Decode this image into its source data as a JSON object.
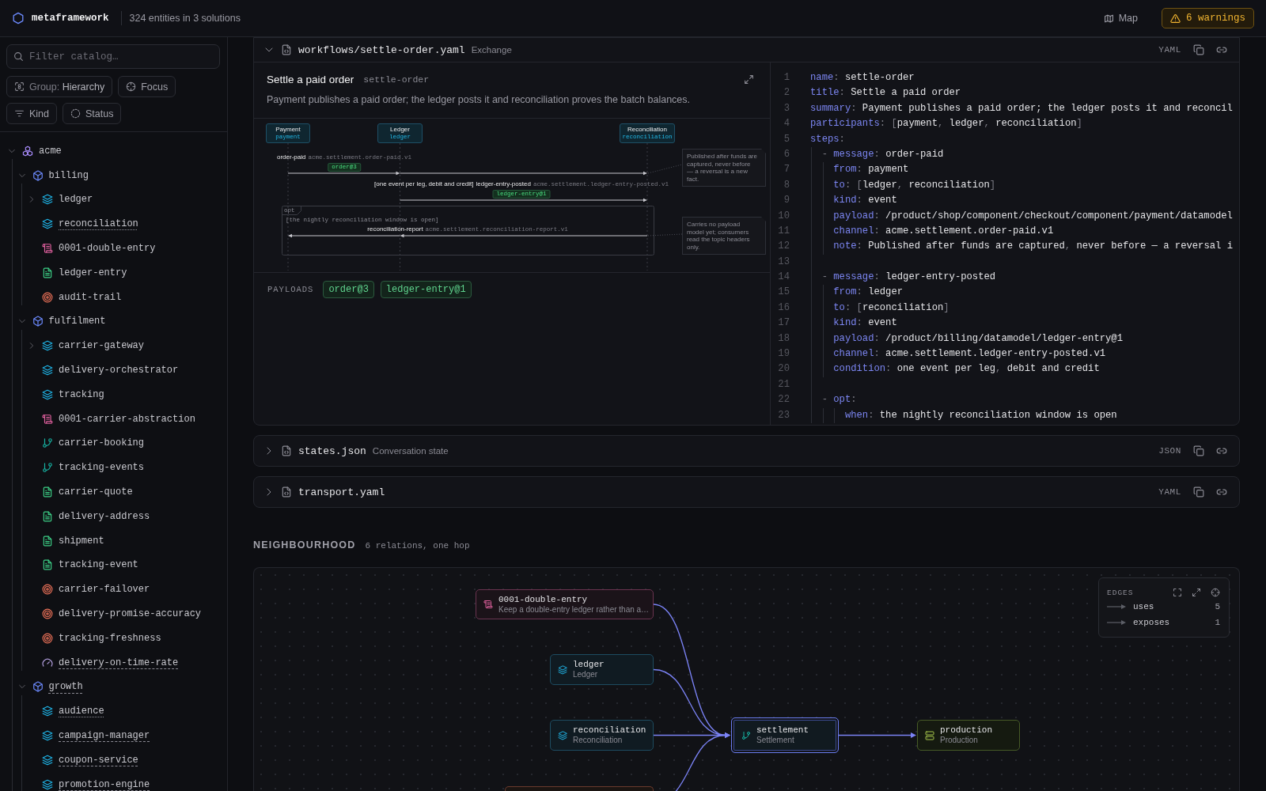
{
  "topbar": {
    "logo": "metaframework",
    "summary": "324 entities in 3 solutions",
    "map_button": "Map",
    "warnings_button": "6 warnings"
  },
  "sidebar": {
    "filter": {
      "placeholder": "Filter catalog…"
    },
    "controls": [
      {
        "kind": "group",
        "label": "Group:",
        "value": "Hierarchy"
      },
      {
        "kind": "focus",
        "label": "Focus"
      },
      {
        "kind": "kind",
        "label": "Kind"
      },
      {
        "kind": "status",
        "label": "Status"
      }
    ],
    "tree": [
      {
        "kind": "solution",
        "label": "acme",
        "expanded": true,
        "children": [
          {
            "kind": "domain",
            "label": "billing",
            "expanded": true,
            "children": [
              {
                "kind": "component",
                "label": "ledger",
                "expanded": false
              },
              {
                "kind": "component",
                "label": "reconciliation",
                "dotted_underline": true
              },
              {
                "kind": "decision",
                "label": "0001-double-entry"
              },
              {
                "kind": "datamodel",
                "label": "ledger-entry"
              },
              {
                "kind": "objective",
                "label": "audit-trail"
              }
            ]
          },
          {
            "kind": "domain",
            "label": "fulfilment",
            "expanded": true,
            "children": [
              {
                "kind": "component",
                "label": "carrier-gateway",
                "expanded": false
              },
              {
                "kind": "component",
                "label": "delivery-orchestrator"
              },
              {
                "kind": "component",
                "label": "tracking"
              },
              {
                "kind": "decision",
                "label": "0001-carrier-abstraction"
              },
              {
                "kind": "flow",
                "label": "carrier-booking"
              },
              {
                "kind": "flow",
                "label": "tracking-events"
              },
              {
                "kind": "datamodel",
                "label": "carrier-quote"
              },
              {
                "kind": "datamodel",
                "label": "delivery-address"
              },
              {
                "kind": "datamodel",
                "label": "shipment"
              },
              {
                "kind": "datamodel",
                "label": "tracking-event"
              },
              {
                "kind": "objective",
                "label": "carrier-failover"
              },
              {
                "kind": "objective",
                "label": "delivery-promise-accuracy"
              },
              {
                "kind": "objective",
                "label": "tracking-freshness"
              },
              {
                "kind": "metric",
                "label": "delivery-on-time-rate",
                "dashed_underline": true
              }
            ]
          },
          {
            "kind": "domain",
            "label": "growth",
            "expanded": true,
            "dashed_underline": true,
            "children": [
              {
                "kind": "component",
                "label": "audience",
                "dotted_underline": true
              },
              {
                "kind": "component",
                "label": "campaign-manager",
                "dashed_underline": true
              },
              {
                "kind": "component",
                "label": "coupon-service",
                "dashed_underline": true
              },
              {
                "kind": "component",
                "label": "promotion-engine",
                "dashed_underline": true
              }
            ]
          }
        ]
      }
    ]
  },
  "files": [
    {
      "expanded": true,
      "path": "workflows/settle-order.yaml",
      "description": "Exchange",
      "format": "YAML",
      "workflow": {
        "title": "Settle a paid order",
        "name": "settle-order",
        "summary": "Payment publishes a paid order; the ledger posts it and reconciliation proves the batch balances.",
        "participants": [
          {
            "title": "Payment",
            "name": "payment"
          },
          {
            "title": "Ledger",
            "name": "ledger"
          },
          {
            "title": "Reconciliation",
            "name": "reconciliation"
          }
        ],
        "messages": [
          {
            "reversed": false,
            "name": "order-paid",
            "channel": "acme.settlement.order-paid.v1",
            "payload": "order@3"
          },
          {
            "reversed": false,
            "guard": "[one event per leg, debit and credit]",
            "name": "ledger-entry-posted",
            "channel": "acme.settlement.ledger-entry-posted.v1",
            "payload": "ledger-entry@1"
          },
          {
            "reversed": true,
            "name": "reconciliation-report",
            "channel": "acme.settlement.reconciliation-report.v1"
          }
        ],
        "fragment": {
          "label": "opt",
          "condition": "[the nightly reconciliation window is open]"
        },
        "notes": [
          "Published after funds are captured, never before — a reversal is a new fact.",
          "Carries no payload model yet; consumers read the topic headers only."
        ],
        "payloads_label": "PAYLOADS",
        "payloads": [
          "order@3",
          "ledger-entry@1"
        ]
      },
      "code": [
        {
          "number": "1",
          "text": "name: settle-order"
        },
        {
          "number": "2",
          "text": "title: Settle a paid order"
        },
        {
          "number": "3",
          "text": "summary: Payment publishes a paid order; the ledger posts it and reconcil"
        },
        {
          "number": "4",
          "text": "participants: [payment, ledger, reconciliation]"
        },
        {
          "number": "5",
          "text": "steps:"
        },
        {
          "number": "6",
          "text": "  - message: order-paid"
        },
        {
          "number": "7",
          "text": "    from: payment"
        },
        {
          "number": "8",
          "text": "    to: [ledger, reconciliation]"
        },
        {
          "number": "9",
          "text": "    kind: event"
        },
        {
          "number": "10",
          "text": "    payload: /product/shop/component/checkout/component/payment/datamodel"
        },
        {
          "number": "11",
          "text": "    channel: acme.settlement.order-paid.v1"
        },
        {
          "number": "12",
          "text": "    note: Published after funds are captured, never before — a reversal i"
        },
        {
          "number": "13"
        },
        {
          "number": "14",
          "text": "  - message: ledger-entry-posted"
        },
        {
          "number": "15",
          "text": "    from: ledger"
        },
        {
          "number": "16",
          "text": "    to: [reconciliation]"
        },
        {
          "number": "17",
          "text": "    kind: event"
        },
        {
          "number": "18",
          "text": "    payload: /product/billing/datamodel/ledger-entry@1"
        },
        {
          "number": "19",
          "text": "    channel: acme.settlement.ledger-entry-posted.v1"
        },
        {
          "number": "20",
          "text": "    condition: one event per leg, debit and credit"
        },
        {
          "number": "21"
        },
        {
          "number": "22",
          "text": "  - opt:"
        },
        {
          "number": "23",
          "text": "      when: the nightly reconciliation window is open"
        }
      ]
    },
    {
      "expanded": false,
      "path": "states.json",
      "description": "Conversation state",
      "format": "JSON"
    },
    {
      "expanded": false,
      "path": "transport.yaml",
      "format": "YAML"
    }
  ],
  "neighbourhood": {
    "title": "NEIGHBOURHOOD",
    "summary": "6 relations, one hop",
    "nodes": [
      {
        "kind": "decision",
        "title": "0001-double-entry",
        "subtitle": "Keep a double-entry ledger rather than a…",
        "incoming": true,
        "selected": false
      },
      {
        "kind": "component",
        "title": "ledger",
        "subtitle": "Ledger",
        "incoming": true,
        "selected": false
      },
      {
        "kind": "component",
        "title": "reconciliation",
        "subtitle": "Reconciliation",
        "incoming": true,
        "selected": false
      },
      {
        "kind": "flow",
        "title": "settlement",
        "subtitle": "Settlement",
        "selected": true
      },
      {
        "kind": "environment",
        "title": "production",
        "subtitle": "Production",
        "outgoing": true,
        "selected": false
      },
      {
        "kind": "objective",
        "incoming": true,
        "selected": false
      }
    ],
    "legend": {
      "title": "EDGES",
      "items": [
        {
          "label": "uses",
          "count": "5"
        },
        {
          "label": "exposes",
          "count": "1"
        }
      ]
    }
  }
}
